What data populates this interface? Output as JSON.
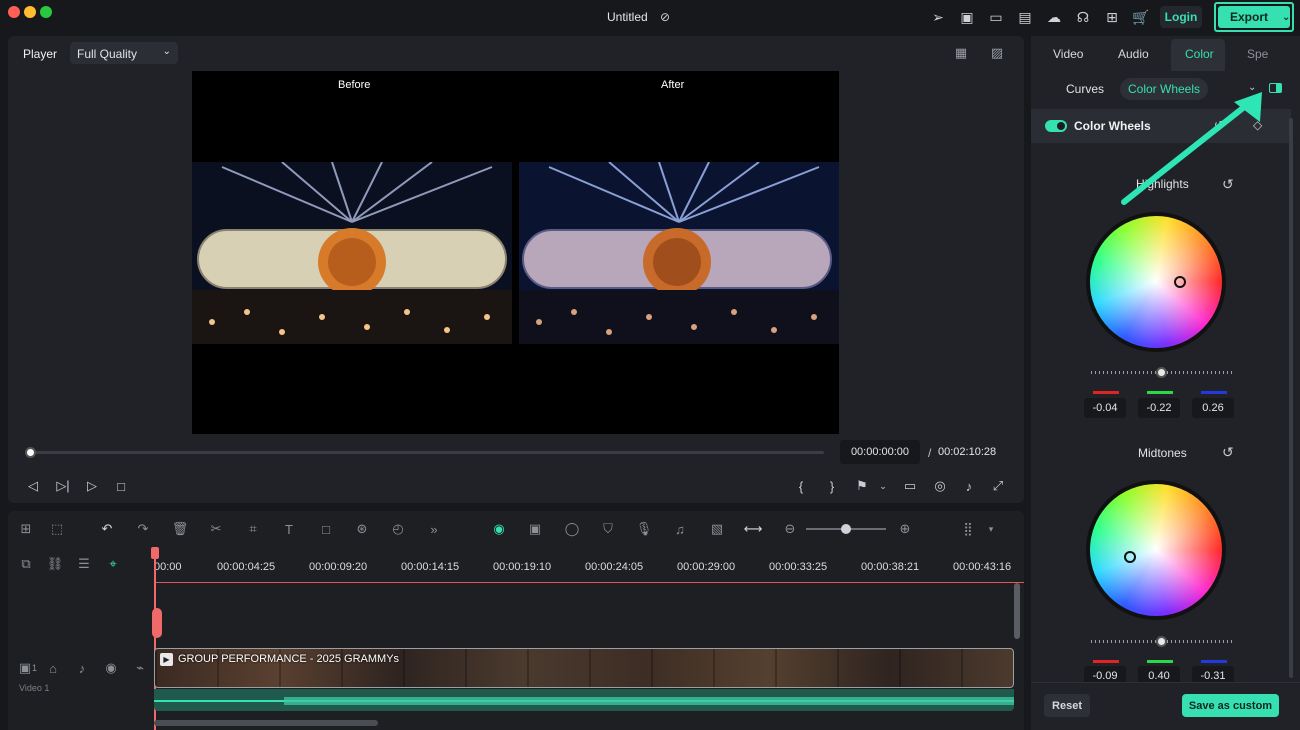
{
  "window": {
    "title": "Untitled"
  },
  "topbar": {
    "login_label": "Login",
    "export_label": "Export"
  },
  "player": {
    "label": "Player",
    "quality": "Full Quality",
    "before_label": "Before",
    "after_label": "After",
    "current_time": "00:00:00:00",
    "separator": "/",
    "total_time": "00:02:10:28"
  },
  "timeline": {
    "ticks": [
      "00:00",
      "00:00:04:25",
      "00:00:09:20",
      "00:00:14:15",
      "00:00:19:10",
      "00:00:24:05",
      "00:00:29:00",
      "00:00:33:25",
      "00:00:38:21",
      "00:00:43:16"
    ],
    "clip_title": "GROUP PERFORMANCE - 2025 GRAMMYs",
    "track_label": "Video 1",
    "track_count": "1"
  },
  "right_panel": {
    "tabs": [
      "Video",
      "Audio",
      "Color",
      "Spe"
    ],
    "active_tab": "Color",
    "subtabs": {
      "curves": "Curves",
      "color_wheels": "Color Wheels"
    },
    "section_title": "Color Wheels",
    "highlights": {
      "label": "Highlights",
      "r": "-0.04",
      "g": "-0.22",
      "b": "0.26"
    },
    "midtones": {
      "label": "Midtones",
      "r": "-0.09",
      "g": "0.40",
      "b": "-0.31"
    },
    "reset_label": "Reset",
    "save_label": "Save as custom"
  },
  "colors": {
    "accent": "#36e0b0",
    "playhead": "#f06a6a",
    "annotation_arrow": "#2ee6b5"
  }
}
